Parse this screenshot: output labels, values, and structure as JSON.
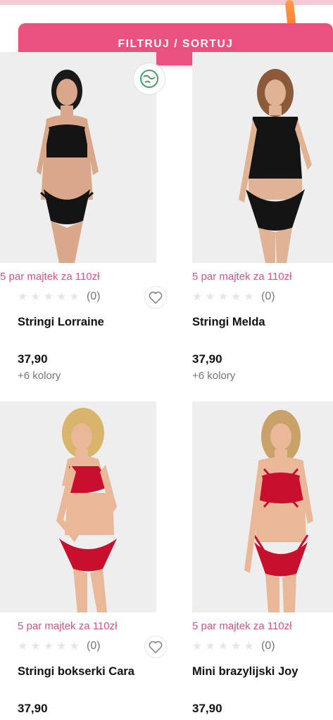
{
  "filter_button": {
    "label": "FILTRUJ / SORTUJ"
  },
  "products": [
    {
      "promo": "5 par majtek za 110zł",
      "rating_count": "(0)",
      "name": "Stringi Lorraine",
      "price": "37,90",
      "colors": "+6 kolory",
      "rating": 0
    },
    {
      "promo": "5 par majtek za 110zł",
      "rating_count": "(0)",
      "name": "Stringi Melda",
      "price": "37,90",
      "colors": "+6 kolory",
      "rating": 0
    },
    {
      "promo": "5 par majtek za 110zł",
      "rating_count": "(0)",
      "name": "Stringi bokserki Cara",
      "price": "37,90",
      "rating": 0
    },
    {
      "promo": "5 par majtek za 110zł",
      "rating_count": "(0)",
      "name": "Mini brazylijski Joy",
      "price": "37,90",
      "rating": 0
    }
  ],
  "icons": {
    "favorite": "heart-icon",
    "rating": "star-icon",
    "eco_badge": "globe-icon"
  },
  "colors": {
    "accent": "#e9527f",
    "promo_text": "#e0507d",
    "image_bg": "#eeeeee",
    "black_set": "#141414",
    "red_set": "#c8102e"
  }
}
